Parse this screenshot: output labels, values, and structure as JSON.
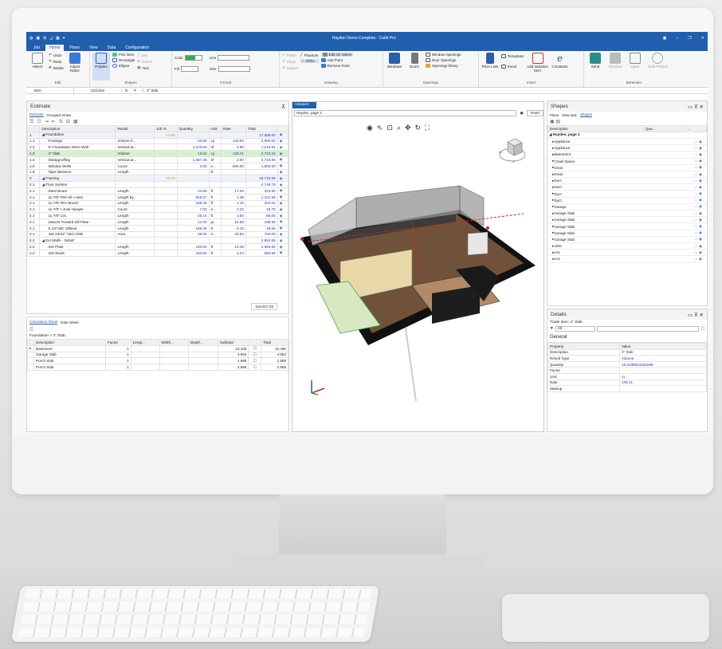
{
  "app": {
    "title": "Hayden Demo Complete - Cubit Pro"
  },
  "menu": [
    "Job",
    "Home",
    "Plans",
    "View",
    "Data",
    "Configuration"
  ],
  "ribbon": {
    "edit": {
      "label": "Edit",
      "select": "Select",
      "undo": "Undo",
      "redo": "Redo",
      "delete": "Delete",
      "adjust": "Adjust Rates"
    },
    "shapes": {
      "label": "Shapes",
      "polyline": "Polyline",
      "pick_lines": "Pick lines",
      "rectangle": "Rectangle",
      "ellipse": "Ellipse",
      "line": "Line",
      "count": "Count",
      "text": "Text"
    },
    "format": {
      "label": "Format",
      "color": "Color",
      "fill": "Fill",
      "line": "Line",
      "size": "Size"
    },
    "drawing": {
      "label": "Drawing",
      "finish": "Finish",
      "close": "Close",
      "cancel": "Cancel",
      "phantom": "Phantom",
      "ortho": "Ortho",
      "edit_on_select": "Edit On Select",
      "add_point": "Add Point",
      "remove_point": "Remove Point"
    },
    "openings": {
      "label": "Openings",
      "windows": "Windows",
      "doors": "Doors",
      "window_openings": "Window Openings",
      "door_openings": "Door Openings",
      "openings_library": "Openings library"
    },
    "insert": {
      "label": "Insert",
      "price_lists": "Price Lists",
      "templates": "Templates",
      "excel": "Excel",
      "add_variation": "Add Variation Item",
      "constants": "Constants"
    },
    "bartender": {
      "label": "Bartender",
      "send": "Send",
      "receive": "Receive",
      "open": "Open",
      "hide_picked": "Hide Picked"
    }
  },
  "formula": {
    "item": "Item",
    "cell": "C62.Des",
    "fx": "fx",
    "value": "4\" Slab"
  },
  "estimate": {
    "title": "Estimate",
    "tabs": [
      "Estimate",
      "Grouped Views"
    ],
    "headers": [
      "",
      "Description",
      "Result",
      "Job %",
      "Quantity",
      "Unit",
      "Rate",
      "Total",
      ""
    ],
    "rows": [
      {
        "id": "1",
        "desc": "◢ Foundation",
        "result": "",
        "job": "14.90",
        "qty": "",
        "unit": "",
        "rate": "",
        "total": "17,668.60",
        "type": "grp"
      },
      {
        "id": "1.1",
        "desc": "Footings",
        "result": "Volume b...",
        "job": "",
        "qty": "20.65",
        "unit": "cy",
        "rate": "140.00",
        "total": "2,890.62",
        "type": ""
      },
      {
        "id": "1.2",
        "desc": "8\" Foundation Stem Wall",
        "result": "Vertical ar...",
        "job": "",
        "qty": "1,510.00",
        "unit": "sf",
        "rate": "4.98",
        "total": "7,519.81",
        "type": ""
      },
      {
        "id": "1.3",
        "desc": "4\" Slab",
        "result": "Volume",
        "job": "",
        "qty": "19.53",
        "unit": "cy",
        "rate": "139.41",
        "total": "2,723.22",
        "type": "sel"
      },
      {
        "id": "1.4",
        "desc": "Dampproffing",
        "result": "Vertical ar...",
        "job": "",
        "qty": "1,367.48",
        "unit": "sf",
        "rate": "2.00",
        "total": "2,734.96",
        "type": ""
      },
      {
        "id": "1.5",
        "desc": "Window Wells",
        "result": "Count",
        "job": "",
        "qty": "3.00",
        "unit": "e...",
        "rate": "600.00",
        "total": "1,800.00",
        "type": ""
      },
      {
        "id": "1.6",
        "desc": "Tape Measure",
        "result": "Length",
        "job": "",
        "qty": "",
        "unit": "ft",
        "rate": "",
        "total": "",
        "type": ""
      },
      {
        "id": "2",
        "desc": "◢ Framing",
        "result": "",
        "job": "20.00",
        "qty": "",
        "unit": "",
        "rate": "",
        "total": "23,718.89",
        "type": "grp"
      },
      {
        "id": "2.1",
        "desc": "◢ Floor System",
        "result": "",
        "job": "",
        "qty": "",
        "unit": "",
        "rate": "",
        "total": "2,749.79",
        "type": ""
      },
      {
        "id": "2.1",
        "desc": "Steel Beam",
        "result": "Length",
        "job": "",
        "qty": "24.88",
        "unit": "ft",
        "rate": "17.00",
        "total": "422.90",
        "type": ""
      },
      {
        "id": "2.1",
        "desc": "11-7/8\" PRI-40 I-Joist",
        "result": "Length by...",
        "job": "",
        "qty": "815.97",
        "unit": "ft",
        "rate": "1.35",
        "total": "1,101.56",
        "type": ""
      },
      {
        "id": "2.1",
        "desc": "11-7/8\" Rim Board",
        "result": "Length",
        "job": "",
        "qty": "185.48",
        "unit": "ft",
        "rate": "1.10",
        "total": "204.03",
        "type": ""
      },
      {
        "id": "2.1",
        "desc": "11-7/8\" I-Joist Hanger",
        "result": "Count",
        "job": "",
        "qty": "7.00",
        "unit": "e...",
        "rate": "2.25",
        "total": "15.75",
        "type": ""
      },
      {
        "id": "2.1",
        "desc": "11-7/8\" LVL",
        "result": "Length",
        "job": "",
        "qty": "25.16",
        "unit": "ft",
        "rate": "3.50",
        "total": "88.05",
        "type": ""
      },
      {
        "id": "2.1",
        "desc": "2x6x16 Treated Sill Plate",
        "result": "Length",
        "job": "",
        "qty": "12.00",
        "unit": "pi...",
        "rate": "16.58",
        "total": "198.96",
        "type": ""
      },
      {
        "id": "2.1",
        "desc": "5 1/2\"x50' Sillseal",
        "result": "Length",
        "job": "",
        "qty": "185.48",
        "unit": "ft",
        "rate": "0.10",
        "total": "18.55",
        "type": ""
      },
      {
        "id": "2.1",
        "desc": "4x8 23/32\" T&G OSB",
        "result": "Area",
        "job": "",
        "qty": "35.00",
        "unit": "s...",
        "rate": "20.00",
        "total": "700.00",
        "type": ""
      },
      {
        "id": "2.2",
        "desc": "◢ Ext Walls - 2x6x8'",
        "result": "",
        "job": "",
        "qty": "",
        "unit": "",
        "rate": "",
        "total": "2,854.88",
        "type": ""
      },
      {
        "id": "2.2",
        "desc": "2x6 Plate",
        "result": "Length",
        "job": "",
        "qty": "160.60",
        "unit": "ft",
        "rate": "10.49",
        "total": "1,683.92",
        "type": ""
      },
      {
        "id": "2.2",
        "desc": "2x6 Studs",
        "result": "Length",
        "job": "",
        "qty": "160.60",
        "unit": "ft",
        "rate": "4.24",
        "total": "680.96",
        "type": ""
      }
    ],
    "grand_total": "118,617.93"
  },
  "calc": {
    "tabs": [
      "Calculation Sheet",
      "Rate Sheet"
    ],
    "breadcrumb": "Foundation > 4\" Slab",
    "headers": [
      "",
      "Description",
      "Factor",
      "Lengt...",
      "Width...",
      "Depth...",
      "Subtotal",
      "",
      "Total"
    ],
    "rows": [
      {
        "desc": "Basement",
        "factor": "1",
        "subtotal": "10.465",
        "total": "10.465"
      },
      {
        "desc": "Garage Slab",
        "factor": "1",
        "subtotal": "4.594",
        "total": "4.594"
      },
      {
        "desc": "Porch Slab",
        "factor": "1",
        "subtotal": "1.889",
        "total": "1.889"
      },
      {
        "desc": "Porch Slab",
        "factor": "1",
        "subtotal": "2.585",
        "total": "2.585"
      }
    ]
  },
  "viewport": {
    "tab": "Viewport",
    "page": "Hayden, page 2",
    "insert": "Insert"
  },
  "shapes_panel": {
    "title": "Shapes",
    "tabs": [
      "Plans",
      "New task",
      "Shapes"
    ],
    "headers": [
      "Description",
      "Qua...",
      "..."
    ],
    "group": "◢ Hayden, page 2",
    "items": [
      "Appliance",
      "Appliance",
      "Basement",
      "Crawl Space",
      "Drain",
      "Drain",
      "Duct",
      "Duct",
      "Duct",
      "Duct",
      "Garage",
      "Garage Slab",
      "Garage Slab",
      "Garage Slab",
      "Garage Slab",
      "Garage Slab",
      "Joist",
      "LVL",
      "LVL"
    ]
  },
  "details": {
    "title": "Details",
    "trade_item": "Trade item: 4\" Slab",
    "filter": "All",
    "section": "General",
    "headers": [
      "Property",
      "Value"
    ],
    "props": [
      {
        "k": "Description",
        "v": "4\" Slab"
      },
      {
        "k": "Result Type",
        "v": "Volume"
      },
      {
        "k": "Quantity",
        "v": "19.5338931651599"
      },
      {
        "k": "Factor",
        "v": ""
      },
      {
        "k": "Unit",
        "v": "cy"
      },
      {
        "k": "Rate",
        "v": "139.41"
      },
      {
        "k": "Markup",
        "v": ""
      }
    ]
  },
  "colors": {
    "titlebar": "#1f5fae",
    "selected_row": "#d8f0cf",
    "value_blue": "#2233bb"
  }
}
